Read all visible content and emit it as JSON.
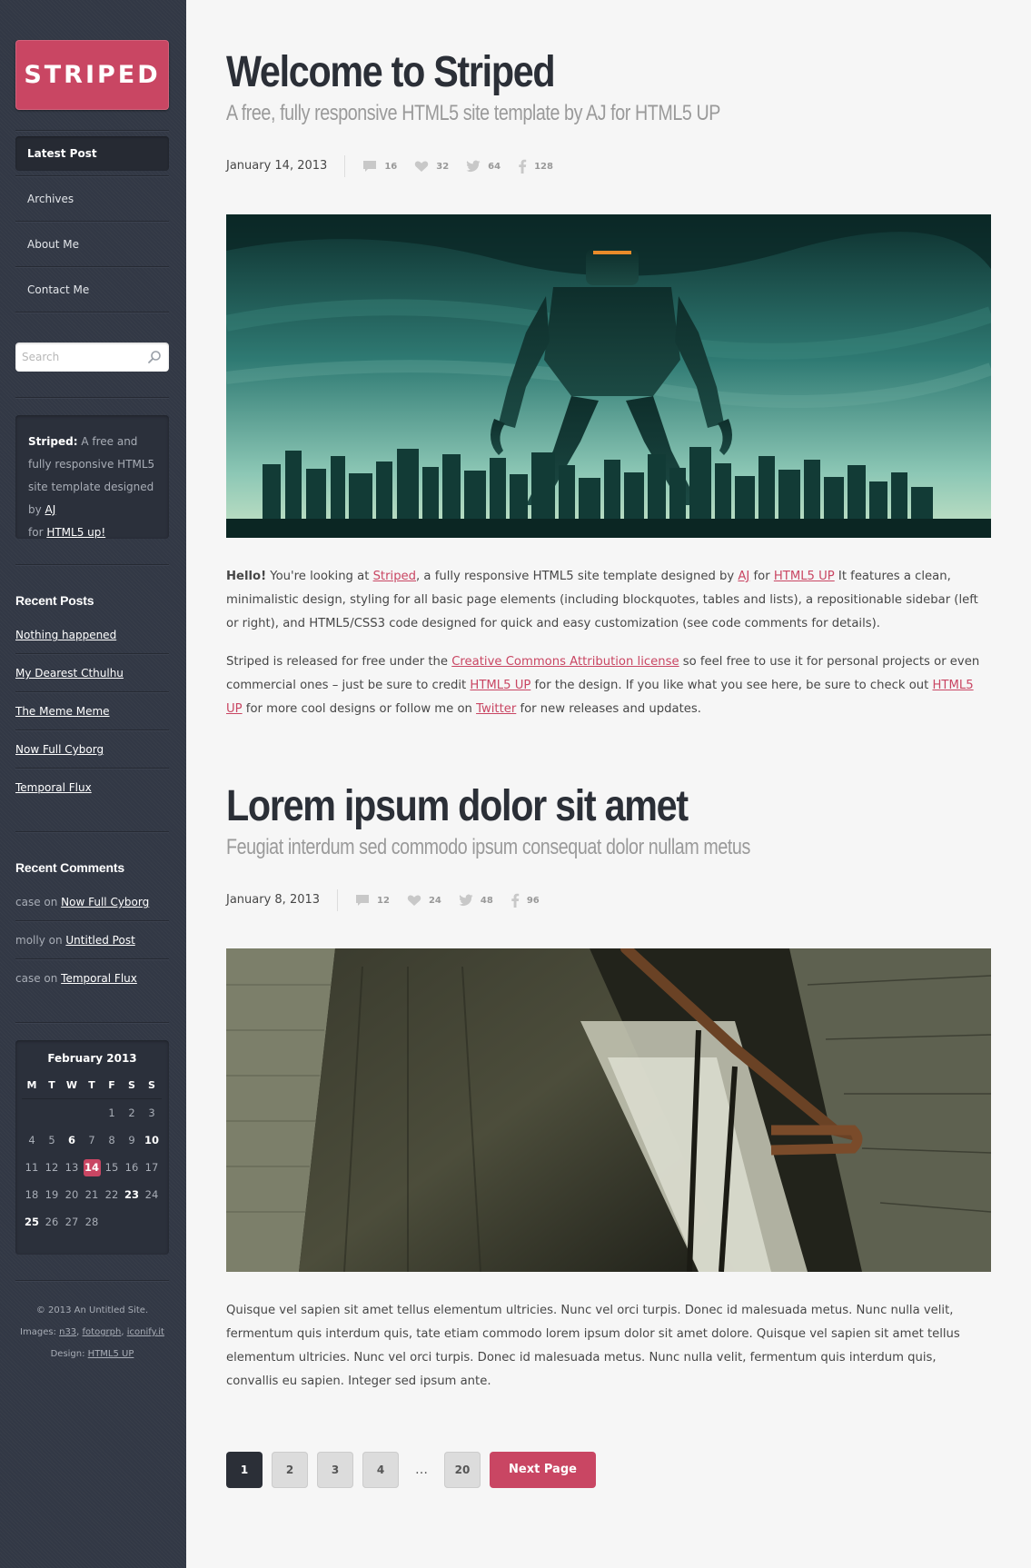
{
  "site": {
    "logo": "STRIPED"
  },
  "nav": [
    {
      "label": "Latest Post",
      "active": true
    },
    {
      "label": "Archives",
      "active": false
    },
    {
      "label": "About Me",
      "active": false
    },
    {
      "label": "Contact Me",
      "active": false
    }
  ],
  "search": {
    "placeholder": "Search"
  },
  "about": {
    "title": "Striped:",
    "text1": " A free and fully responsive HTML5 site template designed by ",
    "link1": "AJ",
    "text2": " for ",
    "link2": "HTML5 up!"
  },
  "recent_posts": {
    "heading": "Recent Posts",
    "items": [
      "Nothing happened",
      "My Dearest Cthulhu",
      "The Meme Meme",
      "Now Full Cyborg",
      "Temporal Flux"
    ]
  },
  "recent_comments": {
    "heading": "Recent Comments",
    "items": [
      {
        "who": "case",
        "on": " on ",
        "post": "Now Full Cyborg"
      },
      {
        "who": "molly",
        "on": " on ",
        "post": "Untitled Post"
      },
      {
        "who": "case",
        "on": " on ",
        "post": "Temporal Flux"
      }
    ]
  },
  "calendar": {
    "title": "February 2013",
    "days": [
      "M",
      "T",
      "W",
      "T",
      "F",
      "S",
      "S"
    ],
    "cells": [
      "",
      "",
      "",
      "",
      "1",
      "2",
      "3",
      "4",
      "5",
      "6",
      "7",
      "8",
      "9",
      "10",
      "11",
      "12",
      "13",
      "14",
      "15",
      "16",
      "17",
      "18",
      "19",
      "20",
      "21",
      "22",
      "23",
      "24",
      "25",
      "26",
      "27",
      "28",
      "",
      "",
      ""
    ],
    "bold": [
      "6",
      "10",
      "23",
      "25"
    ],
    "today": "14"
  },
  "footer": {
    "copyright": "© 2013 An Untitled Site.",
    "images_label": "Images: ",
    "images_links": [
      "n33",
      "fotogrph",
      "iconify.it"
    ],
    "design_label": "Design: ",
    "design_link": "HTML5 UP"
  },
  "posts": [
    {
      "title": "Welcome to Striped",
      "subtitle": "A free, fully responsive HTML5 site template by AJ for HTML5 UP",
      "date": "January 14, 2013",
      "comments": "16",
      "likes": "32",
      "tweets": "64",
      "shares": "128",
      "image": "robot-city-image"
    },
    {
      "title": "Lorem ipsum dolor sit amet",
      "subtitle": "Feugiat interdum sed commodo ipsum consequat dolor nullam metus",
      "date": "January 8, 2013",
      "comments": "12",
      "likes": "24",
      "tweets": "48",
      "shares": "96",
      "image": "stairwell-image"
    }
  ],
  "post1_body": {
    "hello": "Hello!",
    "t1": " You're looking at ",
    "l1": "Striped",
    "t2": ", a fully responsive HTML5 site template designed by ",
    "l2": "AJ",
    "t3": " for ",
    "l3": "HTML5 UP",
    "t4": " It features a clean, minimalistic design, styling for all basic page elements (including blockquotes, tables and lists), a repositionable sidebar (left or right), and HTML5/CSS3 code designed for quick and easy customization (see code comments for details).",
    "p2_t1": "Striped is released for free under the ",
    "p2_l1": "Creative Commons Attribution license",
    "p2_t2": " so feel free to use it for personal projects or even commercial ones – just be sure to credit ",
    "p2_l2": "HTML5 UP",
    "p2_t3": " for the design. If you like what you see here, be sure to check out ",
    "p2_l3": "HTML5 UP",
    "p2_t4": " for more cool designs or follow me on ",
    "p2_l4": "Twitter",
    "p2_t5": " for new releases and updates."
  },
  "post2_body": "Quisque vel sapien sit amet tellus elementum ultricies. Nunc vel orci turpis. Donec id malesuada metus. Nunc nulla velit, fermentum quis interdum quis, tate etiam commodo lorem ipsum dolor sit amet dolore. Quisque vel sapien sit amet tellus elementum ultricies. Nunc vel orci turpis. Donec id malesuada metus. Nunc nulla velit, fermentum quis interdum quis, convallis eu sapien. Integer sed ipsum ante.",
  "pagination": {
    "pages": [
      "1",
      "2",
      "3",
      "4"
    ],
    "ellipsis": "…",
    "last": "20",
    "next": "Next Page",
    "active": "1"
  },
  "colors": {
    "accent": "#c94663",
    "sidebar": "#323845",
    "title": "#2b2f37"
  }
}
